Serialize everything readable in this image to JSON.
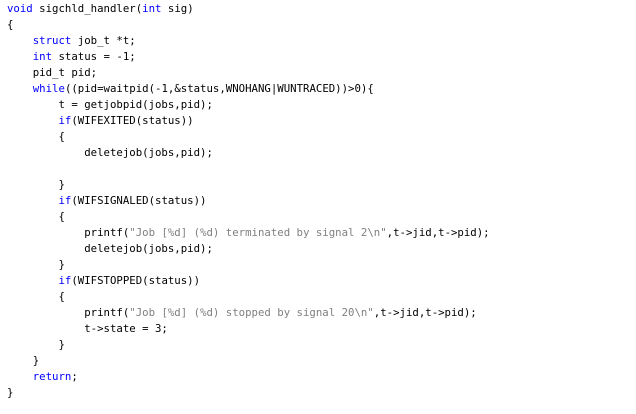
{
  "colors": {
    "background": "#ffffff",
    "text": "#000000",
    "keyword": "#0000ff",
    "string": "#808080",
    "format": "#000080"
  },
  "code_lines": [
    [
      {
        "t": "kw",
        "v": "void"
      },
      {
        "t": "tx",
        "v": " sigchld_handler("
      },
      {
        "t": "kw",
        "v": "int"
      },
      {
        "t": "tx",
        "v": " sig)"
      }
    ],
    [
      {
        "t": "tx",
        "v": "{"
      }
    ],
    [
      {
        "t": "tx",
        "v": "    "
      },
      {
        "t": "kw",
        "v": "struct"
      },
      {
        "t": "tx",
        "v": " job_t *t;"
      }
    ],
    [
      {
        "t": "tx",
        "v": "    "
      },
      {
        "t": "kw",
        "v": "int"
      },
      {
        "t": "tx",
        "v": " status = -1;"
      }
    ],
    [
      {
        "t": "tx",
        "v": "    pid_t pid;"
      }
    ],
    [
      {
        "t": "tx",
        "v": "    "
      },
      {
        "t": "kw",
        "v": "while"
      },
      {
        "t": "tx",
        "v": "((pid=waitpid(-1,&status,WNOHANG|WUNTRACED))>0){"
      }
    ],
    [
      {
        "t": "tx",
        "v": "        t = getjobpid(jobs,pid);"
      }
    ],
    [
      {
        "t": "tx",
        "v": "        "
      },
      {
        "t": "kw",
        "v": "if"
      },
      {
        "t": "tx",
        "v": "(WIFEXITED(status))"
      }
    ],
    [
      {
        "t": "tx",
        "v": "        {"
      }
    ],
    [
      {
        "t": "tx",
        "v": "            deletejob(jobs,pid);"
      }
    ],
    [
      {
        "t": "tx",
        "v": ""
      }
    ],
    [
      {
        "t": "tx",
        "v": "        }"
      }
    ],
    [
      {
        "t": "tx",
        "v": "        "
      },
      {
        "t": "kw",
        "v": "if"
      },
      {
        "t": "tx",
        "v": "(WIFSIGNALED(status))"
      }
    ],
    [
      {
        "t": "tx",
        "v": "        {"
      }
    ],
    [
      {
        "t": "tx",
        "v": "            printf("
      },
      {
        "t": "str",
        "v": "\"Job [%d] (%d) terminated by signal 2\\n\""
      },
      {
        "t": "tx",
        "v": ",t->jid,t->pid);"
      }
    ],
    [
      {
        "t": "tx",
        "v": "            deletejob(jobs,pid);"
      }
    ],
    [
      {
        "t": "tx",
        "v": "        }"
      }
    ],
    [
      {
        "t": "tx",
        "v": "        "
      },
      {
        "t": "kw",
        "v": "if"
      },
      {
        "t": "tx",
        "v": "(WIFSTOPPED(status))"
      }
    ],
    [
      {
        "t": "tx",
        "v": "        {"
      }
    ],
    [
      {
        "t": "tx",
        "v": "            printf("
      },
      {
        "t": "str",
        "v": "\"Job [%d] (%d) stopped by signal 20\\n\""
      },
      {
        "t": "tx",
        "v": ",t->jid,t->pid);"
      }
    ],
    [
      {
        "t": "tx",
        "v": "            t->state = 3;"
      }
    ],
    [
      {
        "t": "tx",
        "v": "        }"
      }
    ],
    [
      {
        "t": "tx",
        "v": "    }"
      }
    ],
    [
      {
        "t": "tx",
        "v": "    "
      },
      {
        "t": "kw",
        "v": "return"
      },
      {
        "t": "tx",
        "v": ";"
      }
    ],
    [
      {
        "t": "tx",
        "v": "}"
      }
    ]
  ]
}
